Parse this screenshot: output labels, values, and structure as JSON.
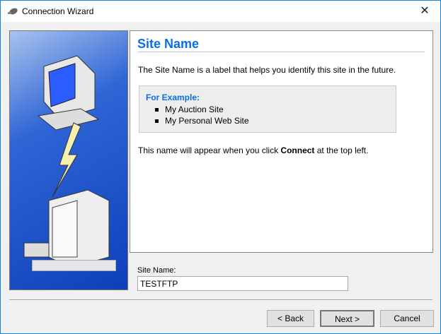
{
  "window": {
    "title": "Connection Wizard",
    "close": "✕"
  },
  "page": {
    "heading": "Site Name",
    "description": "The Site Name is a label that helps you identify this site in the future.",
    "example": {
      "title": "For Example:",
      "items": [
        "My Auction Site",
        "My Personal Web Site"
      ]
    },
    "note_prefix": "This name will appear when you click ",
    "note_bold": "Connect",
    "note_suffix": " at the top left."
  },
  "field": {
    "label": "Site Name:",
    "value": "TESTFTP"
  },
  "buttons": {
    "back": "< Back",
    "next": "Next >",
    "cancel": "Cancel"
  }
}
